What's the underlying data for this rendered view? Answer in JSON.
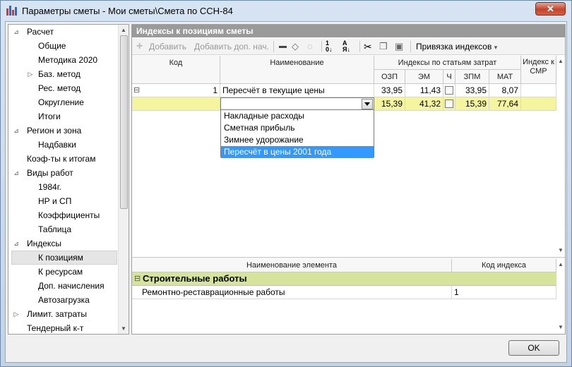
{
  "window": {
    "title": "Параметры сметы - Мои сметы\\Смета по ССН-84",
    "close_label": "✕"
  },
  "tree": {
    "items": [
      {
        "label": "Расчет",
        "expander": "⊿"
      },
      {
        "label": "Общие"
      },
      {
        "label": "Методика 2020"
      },
      {
        "label": "Баз. метод",
        "expander": "▷"
      },
      {
        "label": "Рес. метод"
      },
      {
        "label": "Округление"
      },
      {
        "label": "Итоги"
      },
      {
        "label": "Регион и зона",
        "expander": "⊿"
      },
      {
        "label": "Надбавки"
      },
      {
        "label": "Коэф-ты к итогам"
      },
      {
        "label": "Виды работ",
        "expander": "⊿"
      },
      {
        "label": "1984г."
      },
      {
        "label": "НР и СП"
      },
      {
        "label": "Коэффициенты"
      },
      {
        "label": "Таблица"
      },
      {
        "label": "Индексы",
        "expander": "⊿"
      },
      {
        "label": "К позициям"
      },
      {
        "label": "К ресурсам"
      },
      {
        "label": "Доп. начисления"
      },
      {
        "label": "Автозагрузка"
      },
      {
        "label": "Лимит. затраты",
        "expander": "▷"
      },
      {
        "label": "Тендерный к-т"
      }
    ]
  },
  "section_title": "Индексы к позициям сметы",
  "toolbar": {
    "add": "Добавить",
    "add_extra": "Добавить доп. нач.",
    "binding": "Привязка индексов",
    "binding_arrow": "▾"
  },
  "grid": {
    "headers": {
      "code": "Код",
      "name": "Наименование",
      "group": "Индексы по статьям затрат",
      "ozp": "ОЗП",
      "em": "ЭМ",
      "ch": "Ч",
      "zpm": "ЗПМ",
      "mat": "МАТ",
      "smr": "Индекс к СМР"
    },
    "rows": [
      {
        "expander": "⊟",
        "code": "1",
        "name": "Пересчёт в текущие цены",
        "ozp": "33,95",
        "em": "11,43",
        "zpm": "33,95",
        "mat": "8,07"
      },
      {
        "name": "",
        "ozp": "15,39",
        "em": "41,32",
        "zpm": "15,39",
        "mat": "77,64"
      }
    ]
  },
  "dropdown": {
    "options": [
      "Накладные расходы",
      "Сметная прибыль",
      "Зимнее удорожание",
      "Пересчёт в цены 2001 года"
    ]
  },
  "bottom_grid": {
    "headers": {
      "element": "Наименование элемента",
      "code": "Код индекса"
    },
    "group": "Строительные работы",
    "group_expander": "⊟",
    "rows": [
      {
        "name": "Ремонтно-реставрационные работы",
        "code": "1"
      }
    ]
  },
  "ok_label": "OK",
  "colors": {
    "highlight_row": "#f5f5a0",
    "group_row": "#d6e39a",
    "selection": "#3399ff"
  }
}
